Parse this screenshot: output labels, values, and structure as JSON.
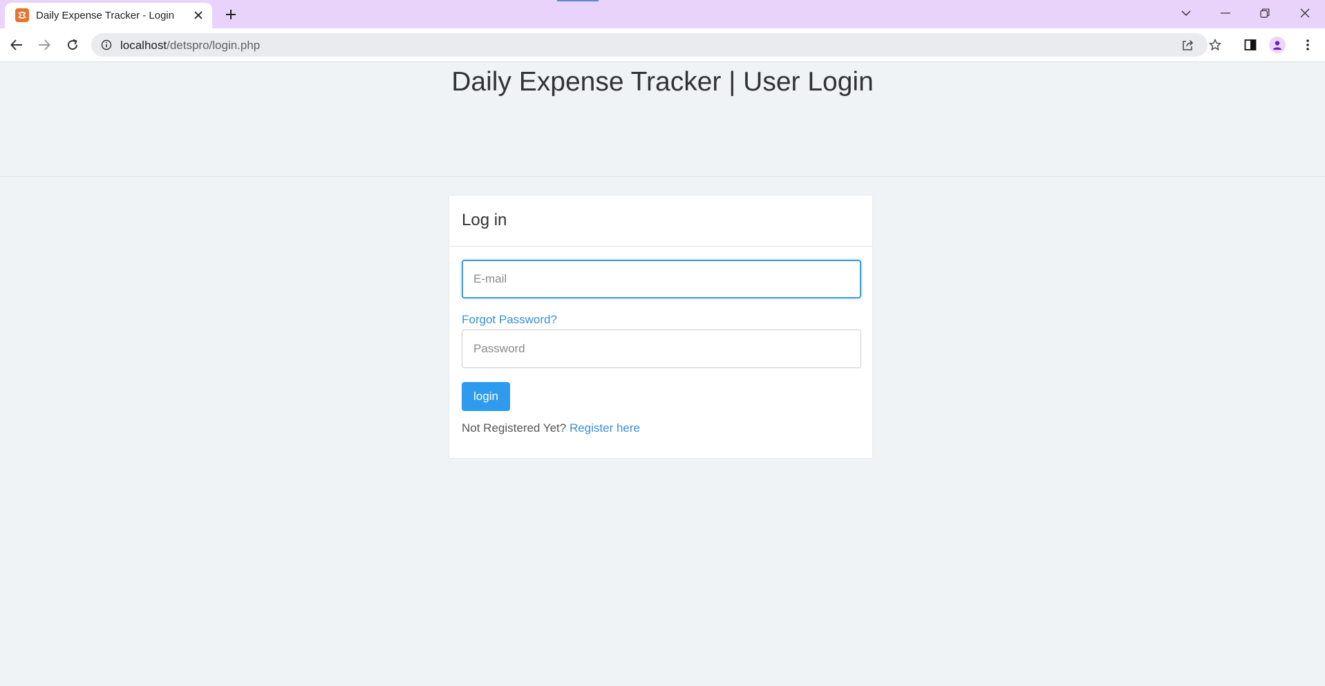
{
  "browser": {
    "tab_title": "Daily Expense Tracker - Login",
    "url_host": "localhost",
    "url_path": "/detspro/login.php"
  },
  "page": {
    "title": "Daily Expense Tracker | User Login"
  },
  "login_panel": {
    "heading": "Log in",
    "email_placeholder": "E-mail",
    "email_value": "",
    "forgot_label": "Forgot Password?",
    "password_placeholder": "Password",
    "password_value": "",
    "login_label": "login",
    "not_registered_text": "Not Registered Yet?",
    "register_label": "Register here"
  },
  "colors": {
    "tabbar": "#e9d3fb",
    "page_background": "#eff3f6",
    "link": "#3a8fd6",
    "primary_button": "#2e9bec",
    "focus_border": "#3f9bd6"
  },
  "icons": {
    "favicon": "xampp-icon",
    "back": "arrow-left-icon",
    "forward": "arrow-right-icon",
    "reload": "reload-icon",
    "site_info": "info-icon",
    "share": "share-icon",
    "bookmark": "star-icon",
    "side_panel": "side-panel-icon",
    "profile": "avatar-icon",
    "menu": "kebab-menu-icon"
  }
}
